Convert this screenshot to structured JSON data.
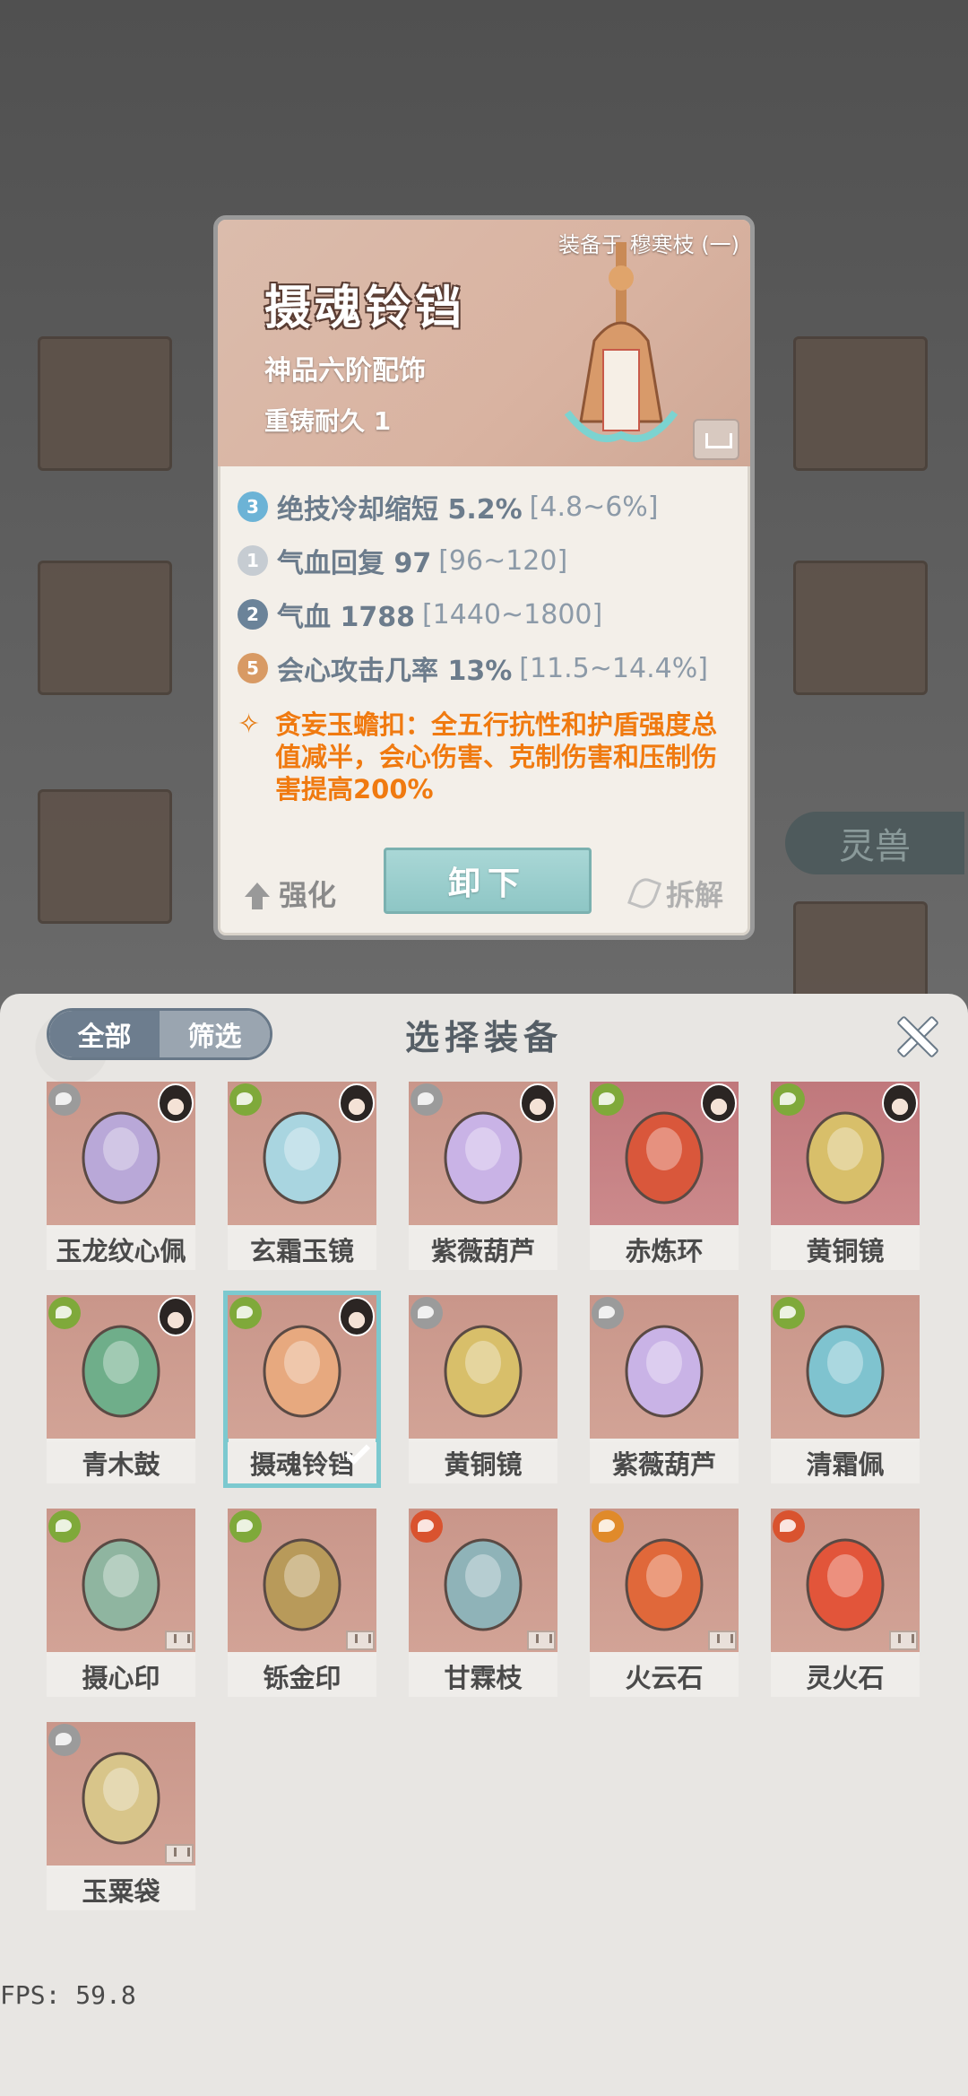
{
  "detail": {
    "equipped_by": "装备于 穆寒枝 (一)",
    "name": "摄魂铃铛",
    "grade": "神品六阶配饰",
    "durability": "重铸耐久 1",
    "stats": [
      {
        "badge": "3",
        "label": "绝技冷却缩短 5.2%",
        "range": "[4.8~6%]",
        "color": "#6cb3d6"
      },
      {
        "badge": "1",
        "label": "气血回复 97",
        "range": "[96~120]",
        "color": "#c6ccd2"
      },
      {
        "badge": "2",
        "label": "气血 1788",
        "range": "[1440~1800]",
        "color": "#6b8399"
      },
      {
        "badge": "5",
        "label": "会心攻击几率 13%",
        "range": "[11.5~14.4%]",
        "color": "#d89a64"
      }
    ],
    "set_effect": "贪妄玉蟾扣：全五行抗性和护盾强度总值减半，会心伤害、克制伤害和压制伤害提高200%",
    "actions": {
      "enhance": "强化",
      "unequip": "卸下",
      "dismantle": "拆解"
    }
  },
  "background": {
    "spirit_beast_tab": "灵兽"
  },
  "panel": {
    "title": "选择装备",
    "filter_all": "全部",
    "filter_screen": "筛选"
  },
  "items": [
    {
      "name": "玉龙纹心佩",
      "elem": "#9b9b9b",
      "avatar": true,
      "selected": false
    },
    {
      "name": "玄霜玉镜",
      "elem": "#7fa93a",
      "avatar": true,
      "selected": false
    },
    {
      "name": "紫薇葫芦",
      "elem": "#9b9b9b",
      "avatar": true,
      "selected": false
    },
    {
      "name": "赤炼环",
      "elem": "#7fa93a",
      "avatar": true,
      "selected": false
    },
    {
      "name": "黄铜镜",
      "elem": "#7fa93a",
      "avatar": true,
      "selected": false
    },
    {
      "name": "青木鼓",
      "elem": "#7fa93a",
      "avatar": true,
      "selected": false
    },
    {
      "name": "摄魂铃铛",
      "elem": "#7fa93a",
      "avatar": true,
      "selected": true
    },
    {
      "name": "黄铜镜",
      "elem": "#9b9b9b",
      "avatar": false,
      "selected": false
    },
    {
      "name": "紫薇葫芦",
      "elem": "#9b9b9b",
      "avatar": false,
      "selected": false
    },
    {
      "name": "清霜佩",
      "elem": "#7fa93a",
      "avatar": false,
      "selected": false
    },
    {
      "name": "摄心印",
      "elem": "#7fa93a",
      "avatar": false,
      "selected": false
    },
    {
      "name": "铄金印",
      "elem": "#7fa93a",
      "avatar": false,
      "selected": false
    },
    {
      "name": "甘霖枝",
      "elem": "#d9532f",
      "avatar": false,
      "selected": false
    },
    {
      "name": "火云石",
      "elem": "#e08a2a",
      "avatar": false,
      "selected": false
    },
    {
      "name": "灵火石",
      "elem": "#d9532f",
      "avatar": false,
      "selected": false
    },
    {
      "name": "玉粟袋",
      "elem": "#9b9b9b",
      "avatar": false,
      "selected": false
    }
  ],
  "fps": "FPS: 59.8"
}
